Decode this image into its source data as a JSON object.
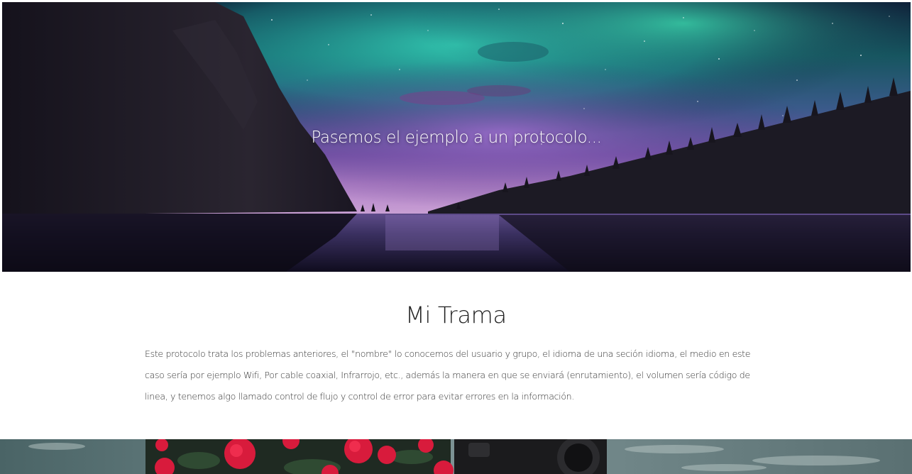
{
  "hero": {
    "caption": "Pasemos el ejemplo a un protocolo..."
  },
  "section": {
    "title": "Mi Trama",
    "body": "Este protocolo trata los problemas anteriores, el \"nombre\" lo conocemos del usuario y grupo, el idioma de una seción idioma, el medio en este caso sería por ejemplo Wifi, Por cable coaxial, Infrarrojo, etc., además la manera en que se enviará (enrutamiento), el volumen sería código de linea, y tenemos algo llamado control de flujo y control de error para evitar errores en la información."
  },
  "colors": {
    "aurora_teal": "#2fb8a4",
    "aurora_violet": "#7d4fb0",
    "night_sky": "#101a33",
    "lake": "#2a2445",
    "rose_red": "#d81b3c",
    "text_dark": "#222222"
  }
}
